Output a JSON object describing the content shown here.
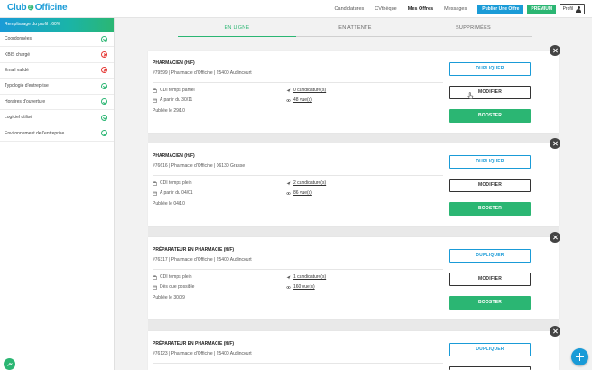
{
  "header": {
    "logo_left": "Club",
    "logo_right": "Officine",
    "nav": [
      "Candidatures",
      "CVthèque",
      "Mes Offres",
      "Messages"
    ],
    "publish_label": "Publier Une Offre",
    "premium_label": "PREMIUM",
    "profile_label": "Profil"
  },
  "sidebar": {
    "completion": "Remplissage du profil : 60%",
    "items": [
      {
        "label": "Coordonnées",
        "status": "ok"
      },
      {
        "label": "KBIS chargé",
        "status": "error"
      },
      {
        "label": "Email validé",
        "status": "error"
      },
      {
        "label": "Typologie d'entreprise",
        "status": "ok"
      },
      {
        "label": "Horaires d'ouverture",
        "status": "ok"
      },
      {
        "label": "Logiciel utilisé",
        "status": "ok"
      },
      {
        "label": "Environnement de l'entreprise",
        "status": "ok"
      }
    ]
  },
  "tabs": [
    "EN LIGNE",
    "EN ATTENTE",
    "SUPPRIMÉES"
  ],
  "buttons": {
    "duplicate": "DUPLIQUER",
    "modify": "MODIFIER",
    "boost": "BOOSTER"
  },
  "offers": [
    {
      "title": "PHARMACIEN (H/F)",
      "ref": "#79599 | Pharmacie d'Officine | 25400 Audincourt",
      "contract": "CDI temps partiel",
      "start": "A partir du 30/11",
      "published": "Publiée le 29/10",
      "applications": "0 candidature(s)",
      "views": "48 vue(s)"
    },
    {
      "title": "PHARMACIEN (H/F)",
      "ref": "#76616 | Pharmacie d'Officine | 06130 Grasse",
      "contract": "CDI temps plein",
      "start": "A partir du 04/01",
      "published": "Publiée le 04/10",
      "applications": "2 candidature(s)",
      "views": "86 vue(s)"
    },
    {
      "title": "PRÉPARATEUR EN PHARMACIE (H/F)",
      "ref": "#76317 | Pharmacie d'Officine | 25400 Audincourt",
      "contract": "CDI temps plein",
      "start": "Dès que possible",
      "published": "Publiée le 30/09",
      "applications": "1 candidature(s)",
      "views": "160 vue(s)"
    },
    {
      "title": "PRÉPARATEUR EN PHARMACIE (H/F)",
      "ref": "#76123 | Pharmacie d'Officine | 25400 Audincourt",
      "contract": "",
      "start": "",
      "published": "",
      "applications": "",
      "views": ""
    }
  ],
  "colors": {
    "brand_blue": "#1a9bd7",
    "brand_green": "#2bb673",
    "error_red": "#e53935"
  }
}
